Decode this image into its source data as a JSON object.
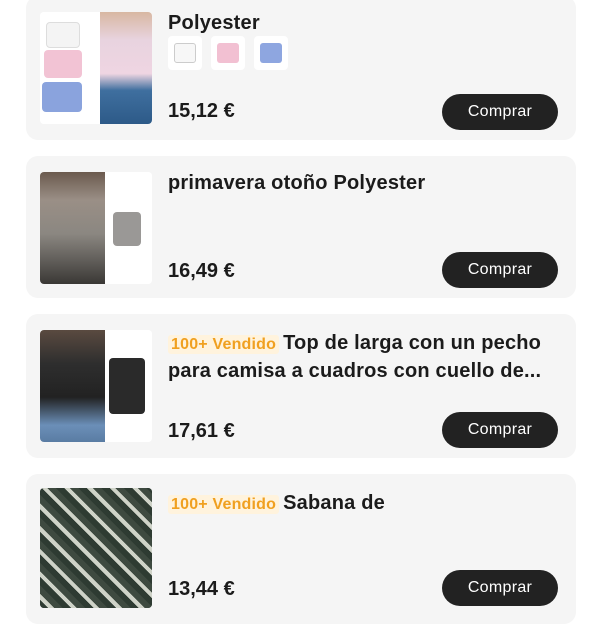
{
  "products": [
    {
      "title": "Polyester",
      "badge": "",
      "price": "15,12 €",
      "button_label": "Comprar",
      "swatches": [
        "white-shirt",
        "pink-shirt",
        "blue-shirt"
      ]
    },
    {
      "title": "primavera otoño Polyester",
      "badge": "",
      "price": "16,49 €",
      "button_label": "Comprar"
    },
    {
      "title": "Top de larga con un pecho para camisa a cuadros con cuello de...",
      "badge": "100+ Vendido",
      "price": "17,61 €",
      "button_label": "Comprar"
    },
    {
      "title": "Sabana de",
      "badge": "100+ Vendido",
      "price": "13,44 €",
      "button_label": "Comprar"
    }
  ],
  "colors": {
    "card_bg": "#f5f5f5",
    "button_bg": "#222222",
    "badge_text": "#f0a020",
    "badge_bg": "#fff3dd"
  }
}
